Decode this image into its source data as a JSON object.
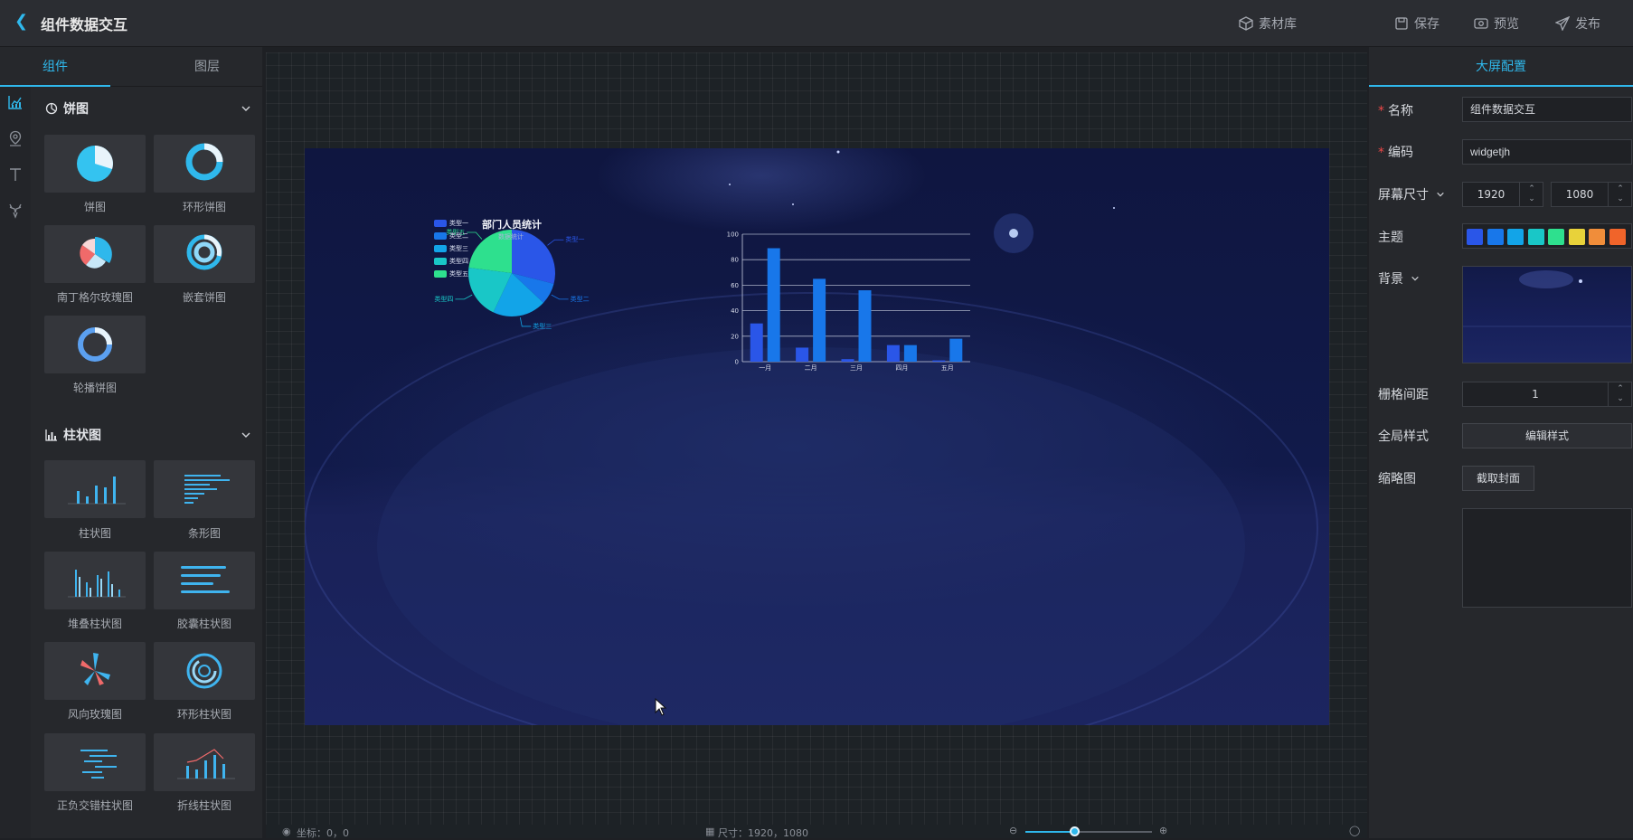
{
  "header": {
    "title": "组件数据交互",
    "material_label": "素材库",
    "save_label": "保存",
    "preview_label": "预览",
    "publish_label": "发布"
  },
  "left": {
    "tabs": [
      "组件",
      "图层"
    ],
    "categories": [
      {
        "name": "饼图",
        "items": [
          "饼图",
          "环形饼图",
          "南丁格尔玫瑰图",
          "嵌套饼图",
          "轮播饼图"
        ]
      },
      {
        "name": "柱状图",
        "items": [
          "柱状图",
          "条形图",
          "堆叠柱状图",
          "胶囊柱状图",
          "风向玫瑰图",
          "环形柱状图",
          "正负交错柱状图",
          "折线柱状图"
        ]
      }
    ]
  },
  "canvas": {
    "pie_title": "部门人员统计",
    "pie_subtitle": "数据统计",
    "pie_legend": [
      "类型一",
      "类型二",
      "类型三",
      "类型四",
      "类型五"
    ],
    "bar_ticks": [
      "100",
      "80",
      "60",
      "40",
      "20",
      "0"
    ],
    "bar_categories": [
      "一月",
      "二月",
      "三月",
      "四月",
      "五月"
    ]
  },
  "chart_data": [
    {
      "type": "pie",
      "title": "部门人员统计",
      "subtitle": "数据统计",
      "categories": [
        "类型一",
        "类型二",
        "类型三",
        "类型四",
        "类型五"
      ],
      "values": [
        29,
        8,
        20,
        20,
        23
      ],
      "colors": [
        "#2a56e8",
        "#1877ea",
        "#12a4e8",
        "#19c7c7",
        "#2ee08e"
      ],
      "legend": "top-left"
    },
    {
      "type": "bar",
      "categories": [
        "一月",
        "二月",
        "三月",
        "四月",
        "五月"
      ],
      "series": [
        {
          "values": [
            30,
            11,
            2,
            13,
            1
          ],
          "color": "#2a56e8"
        },
        {
          "values": [
            89,
            65,
            56,
            13,
            18
          ],
          "color": "#1877ea"
        }
      ],
      "ylim": [
        0,
        100
      ],
      "yticks": [
        0,
        20,
        40,
        60,
        80,
        100
      ],
      "grid": true
    }
  ],
  "right": {
    "tab_label": "大屏配置",
    "name_label": "名称",
    "name_value": "组件数据交互",
    "code_label": "编码",
    "code_value": "widgetjh",
    "size_label": "屏幕尺寸",
    "width_value": "1920",
    "height_value": "1080",
    "theme_label": "主题",
    "theme_colors": [
      "#2a56e8",
      "#1877ea",
      "#12a4e8",
      "#19c7c7",
      "#2ee08e",
      "#e8d23a",
      "#f08d3a",
      "#f0642a"
    ],
    "bg_label": "背景",
    "grid_label": "栅格间距",
    "grid_value": "1",
    "style_label": "全局样式",
    "edit_style_label": "编辑样式",
    "thumb_label": "缩略图",
    "capture_label": "截取封面"
  },
  "status": {
    "coords": "坐标：0，0",
    "size": "尺寸：1920，1080"
  }
}
